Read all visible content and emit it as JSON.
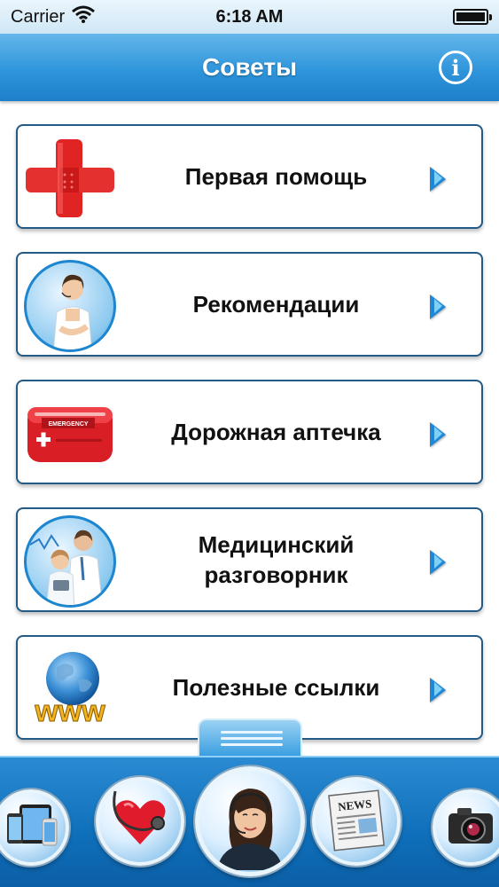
{
  "status_bar": {
    "carrier": "Carrier",
    "time": "6:18 AM"
  },
  "nav": {
    "title": "Советы",
    "info_glyph": "i"
  },
  "menu": {
    "items": [
      {
        "label": "Первая помощь",
        "icon": "bandage-cross-icon"
      },
      {
        "label": "Рекомендации",
        "icon": "operator-woman-photo"
      },
      {
        "label": "Дорожная аптечка",
        "icon": "first-aid-kit-icon"
      },
      {
        "label": "Медицинский разговорник",
        "icon": "doctors-photo"
      },
      {
        "label": "Полезные ссылки",
        "icon": "globe-www-icon"
      }
    ]
  },
  "dock": {
    "items": [
      {
        "icon": "devices-icon"
      },
      {
        "icon": "stethoscope-heart-icon"
      },
      {
        "icon": "operator-icon",
        "selected": true
      },
      {
        "icon": "news-icon",
        "text": "NEWS"
      },
      {
        "icon": "camera-icon"
      }
    ]
  },
  "thumb_texts": {
    "kit_badge": "EMERGENCY",
    "www": "www"
  },
  "colors": {
    "nav_blue": "#2f95db",
    "card_border": "#245b86",
    "arrow_blue": "#1e88d6",
    "dock_blue": "#0f6fba"
  }
}
